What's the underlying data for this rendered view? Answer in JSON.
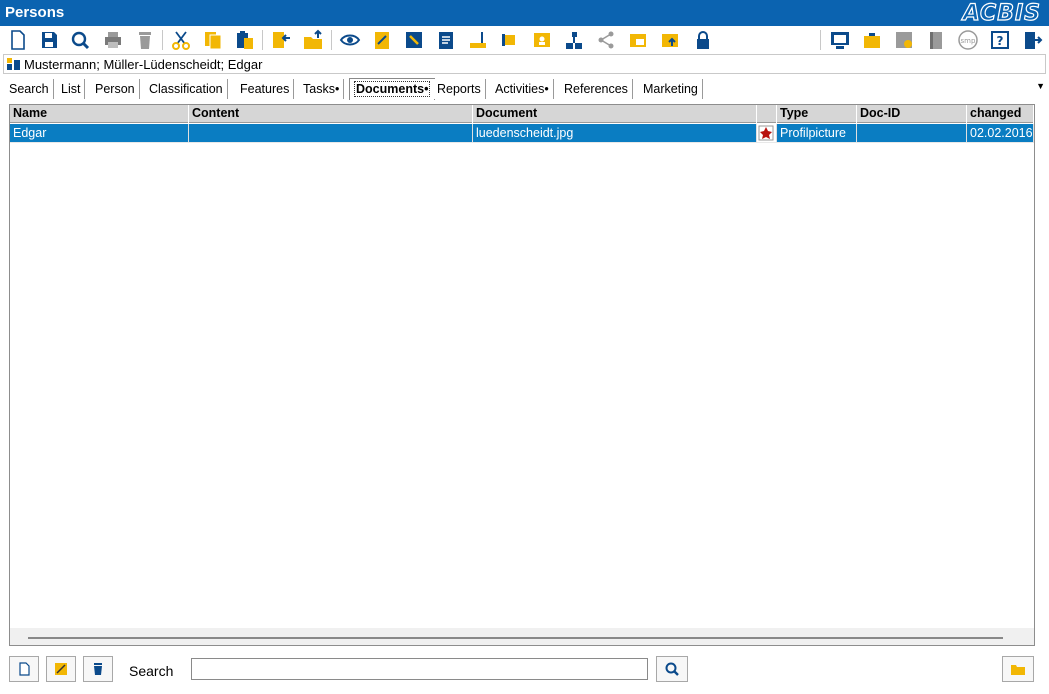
{
  "window": {
    "title": "Persons",
    "logo_text": "ACBIS"
  },
  "toolbar": {
    "buttons": [
      "new-icon",
      "save-icon",
      "search-icon",
      "print-icon",
      "delete-icon",
      "cut-icon",
      "copy-icon",
      "paste-icon",
      "import-icon",
      "folder-upload-icon",
      "view-icon",
      "edit-note-icon",
      "tools-icon",
      "document-list-icon",
      "ruler-icon",
      "tag-icon",
      "contact-card-icon",
      "org-chart-icon",
      "share-icon",
      "window-icon",
      "window-up-icon",
      "lock-icon",
      "monitor-chart-icon",
      "briefcase-icon",
      "certificate-icon",
      "book-icon",
      "smp-icon",
      "help-icon",
      "exit-icon"
    ]
  },
  "breadcrumb": {
    "text": "Mustermann; Müller-Lüdenscheidt; Edgar"
  },
  "tabs": [
    {
      "label": "Search"
    },
    {
      "label": "List"
    },
    {
      "label": "Person"
    },
    {
      "label": "Classification"
    },
    {
      "label": "Features"
    },
    {
      "label": "Tasks•"
    },
    {
      "label": "Documents•"
    },
    {
      "label": "Reports"
    },
    {
      "label": "Activities•"
    },
    {
      "label": "References"
    },
    {
      "label": "Marketing"
    }
  ],
  "grid": {
    "columns": [
      "Name",
      "Content",
      "Document",
      "",
      "Type",
      "Doc-ID",
      "changed"
    ],
    "rows": [
      {
        "name": "Edgar",
        "content": "",
        "document": "luedenscheidt.jpg",
        "icon": "image-file-icon",
        "type": "Profilpicture",
        "doc_id": "",
        "changed": "02.02.2016"
      }
    ]
  },
  "bottom": {
    "search_label": "Search",
    "search_value": ""
  },
  "colors": {
    "title_bar": "#0b63b0",
    "selected_row": "#0a7dc2",
    "icon_yellow": "#f2b705",
    "icon_blue": "#0b4a8b"
  }
}
